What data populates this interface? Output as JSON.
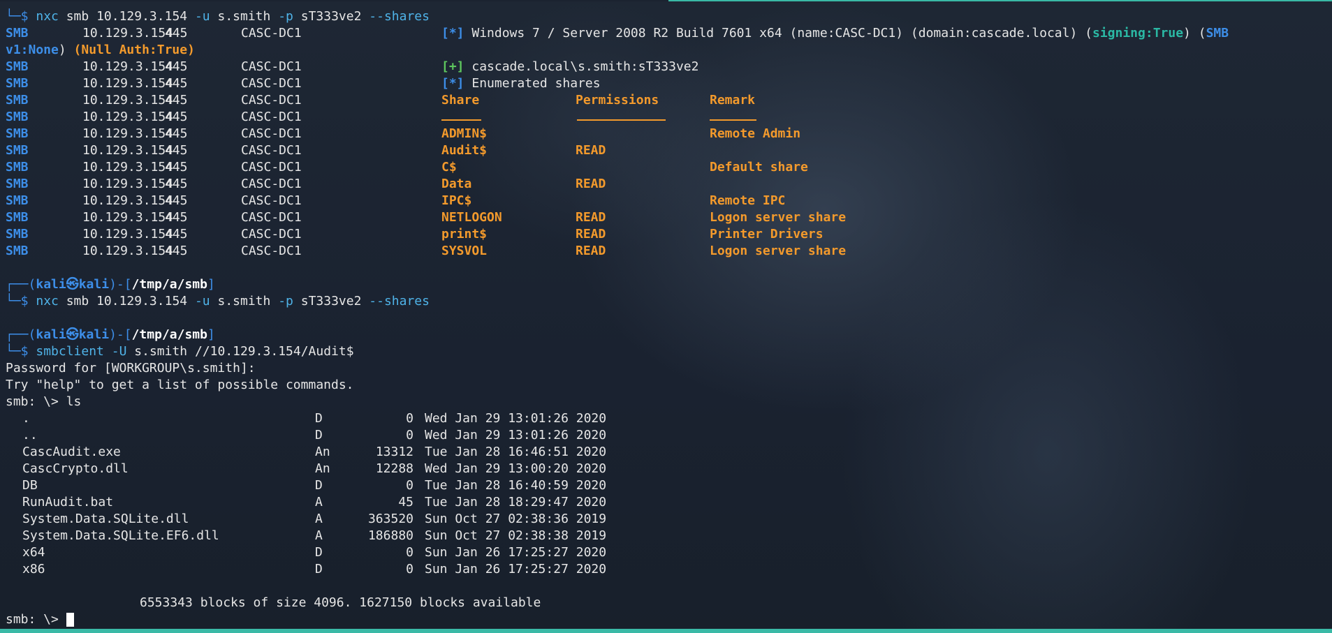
{
  "prompt": {
    "user": "kali",
    "host": "kali",
    "symbol": "㉿",
    "path": "/tmp/a/smb"
  },
  "commands": {
    "first": "nxc smb 10.129.3.154 -u s.smith -p sT333ve2 --shares",
    "second": "nxc smb 10.129.3.154 -u s.smith -p sT333ve2 --shares",
    "third": "smbclient -U s.smith //10.129.3.154/Audit$"
  },
  "nxc": {
    "proto": "SMB",
    "ip": "10.129.3.154",
    "port": "445",
    "host": "CASC-DC1",
    "info_marker": "[*]",
    "plus_marker": "[+]",
    "info_line": "Windows 7 / Server 2008 R2 Build 7601 x64 (name:CASC-DC1) (domain:cascade.local) (",
    "signing": "signing:True",
    "info_close": ") (",
    "smbv1_a": "SMB",
    "smbv1_b": "v1:None",
    "null_auth": "(Null Auth:True)",
    "auth_line": "cascade.local\\s.smith:sT333ve2",
    "enum_line": "Enumerated shares",
    "headers": {
      "share": "Share",
      "permissions": "Permissions",
      "remark": "Remark"
    },
    "shares": [
      {
        "name": "ADMIN$",
        "perm": "",
        "remark": "Remote Admin"
      },
      {
        "name": "Audit$",
        "perm": "READ",
        "remark": ""
      },
      {
        "name": "C$",
        "perm": "",
        "remark": "Default share"
      },
      {
        "name": "Data",
        "perm": "READ",
        "remark": ""
      },
      {
        "name": "IPC$",
        "perm": "",
        "remark": "Remote IPC"
      },
      {
        "name": "NETLOGON",
        "perm": "READ",
        "remark": "Logon server share"
      },
      {
        "name": "print$",
        "perm": "READ",
        "remark": "Printer Drivers"
      },
      {
        "name": "SYSVOL",
        "perm": "READ",
        "remark": "Logon server share"
      }
    ]
  },
  "smbclient": {
    "password_prompt": "Password for [WORKGROUP\\s.smith]:",
    "help_line": "Try \"help\" to get a list of possible commands.",
    "ls_prompt": "smb: \\> ls",
    "files": [
      {
        "name": ".",
        "attr": "D",
        "size": "0",
        "date": "Wed Jan 29 13:01:26 2020"
      },
      {
        "name": "..",
        "attr": "D",
        "size": "0",
        "date": "Wed Jan 29 13:01:26 2020"
      },
      {
        "name": "CascAudit.exe",
        "attr": "An",
        "size": "13312",
        "date": "Tue Jan 28 16:46:51 2020"
      },
      {
        "name": "CascCrypto.dll",
        "attr": "An",
        "size": "12288",
        "date": "Wed Jan 29 13:00:20 2020"
      },
      {
        "name": "DB",
        "attr": "D",
        "size": "0",
        "date": "Tue Jan 28 16:40:59 2020"
      },
      {
        "name": "RunAudit.bat",
        "attr": "A",
        "size": "45",
        "date": "Tue Jan 28 18:29:47 2020"
      },
      {
        "name": "System.Data.SQLite.dll",
        "attr": "A",
        "size": "363520",
        "date": "Sun Oct 27 02:38:36 2019"
      },
      {
        "name": "System.Data.SQLite.EF6.dll",
        "attr": "A",
        "size": "186880",
        "date": "Sun Oct 27 02:38:38 2019"
      },
      {
        "name": "x64",
        "attr": "D",
        "size": "0",
        "date": "Sun Jan 26 17:25:27 2020"
      },
      {
        "name": "x86",
        "attr": "D",
        "size": "0",
        "date": "Sun Jan 26 17:25:27 2020"
      }
    ],
    "blocks_line": "6553343 blocks of size 4096. 1627150 blocks available",
    "final_prompt": "smb: \\> "
  },
  "colors": {
    "smb_blue": "#3d8ee8",
    "orange": "#f39a2c",
    "teal": "#2bb8a4",
    "status_bar": "#3ab9a6"
  }
}
